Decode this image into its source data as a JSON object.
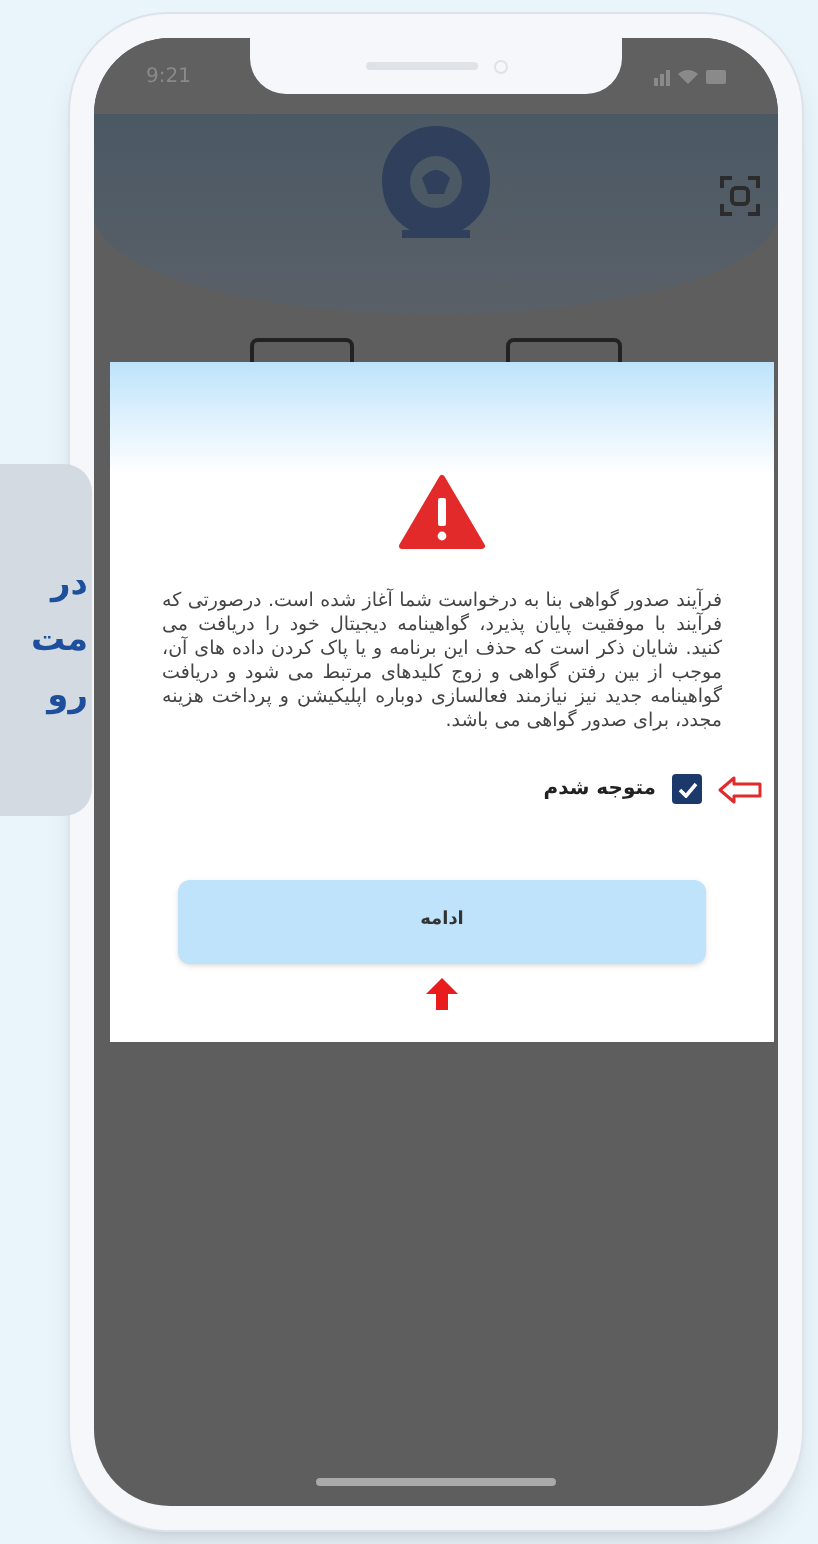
{
  "status_bar": {
    "time": "9:21"
  },
  "callout": {
    "lines": [
      "در",
      "مت",
      "رو"
    ]
  },
  "dialog": {
    "message": "فرآیند صدور گواهی بنا به درخواست شما آغاز شده است. درصورتی که فرآیند با موفقیت پایان پذیرد، گواهینامه دیجیتال خود را دریافت می کنید. شایان ذکر است که حذف این برنامه و یا پاک کردن داده های آن، موجب از بین رفتن گواهی و زوج کلیدهای مرتبط می شود و دریافت گواهینامه جدید نیز نیازمند فعالسازی دوباره اپلیکیشن و پرداخت هزینه مجدد، برای صدور گواهی می باشد.",
    "acknowledge": {
      "label": "متوجه شدم",
      "checked": true
    },
    "button": {
      "label": "ادامه"
    }
  }
}
